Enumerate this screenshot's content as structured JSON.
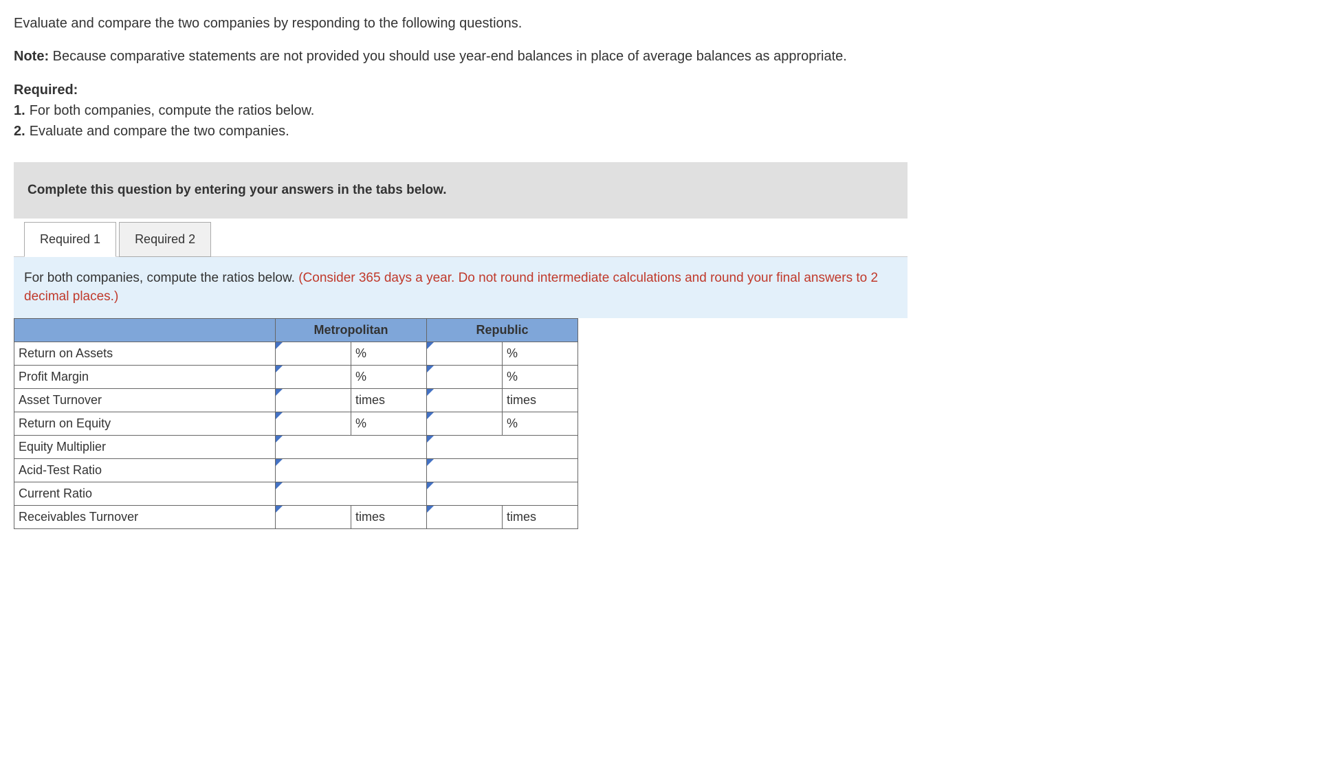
{
  "intro": "Evaluate and compare the two companies by responding to the following questions.",
  "note": {
    "label": "Note:",
    "text": " Because comparative statements are not provided you should use year-end balances in place of average balances as appropriate."
  },
  "required": {
    "label": "Required:",
    "items": [
      {
        "num": "1.",
        "text": "For both companies, compute the ratios below."
      },
      {
        "num": "2.",
        "text": "Evaluate and compare the two companies."
      }
    ]
  },
  "banner": "Complete this question by entering your answers in the tabs below.",
  "tabs": [
    {
      "label": "Required 1",
      "active": true
    },
    {
      "label": "Required 2",
      "active": false
    }
  ],
  "tab_content": {
    "main": "For both companies, compute the ratios below. ",
    "hint": "(Consider 365 days a year. Do not round intermediate calculations and round your final answers to 2 decimal places.)"
  },
  "table": {
    "headers": [
      "Metropolitan",
      "Republic"
    ],
    "rows": [
      {
        "label": "Return on Assets",
        "unit": "%"
      },
      {
        "label": "Profit Margin",
        "unit": "%"
      },
      {
        "label": "Asset Turnover",
        "unit": "times"
      },
      {
        "label": "Return on Equity",
        "unit": "%"
      },
      {
        "label": "Equity Multiplier",
        "unit": ""
      },
      {
        "label": "Acid-Test Ratio",
        "unit": ""
      },
      {
        "label": "Current Ratio",
        "unit": ""
      },
      {
        "label": "Receivables Turnover",
        "unit": "times"
      }
    ]
  }
}
